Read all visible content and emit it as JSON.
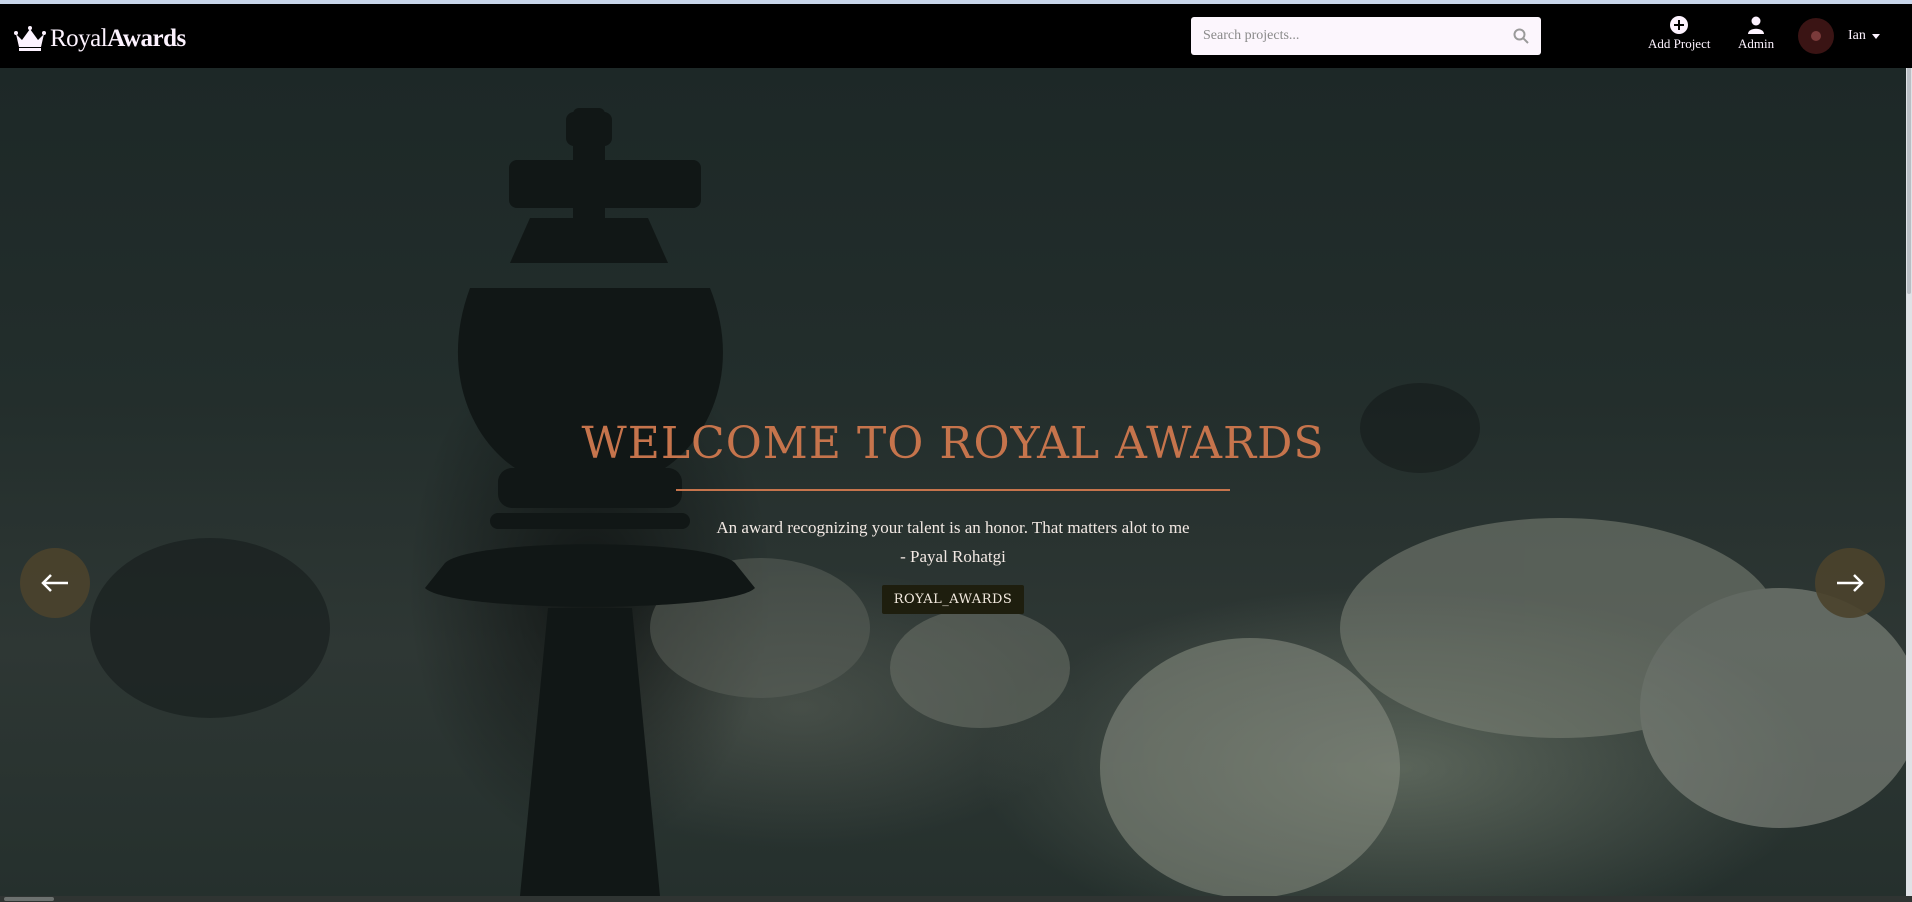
{
  "brand": {
    "part1": "Royal",
    "part2": "Awards"
  },
  "search": {
    "placeholder": "Search projects..."
  },
  "nav": {
    "add_project": "Add Project",
    "admin": "Admin",
    "user_name": "Ian"
  },
  "carousel": {
    "title": "WELCOME TO ROYAL AWARDS",
    "quote_line1": "An award recognizing your talent is an honor. That matters alot to me",
    "quote_line2": "- Payal Rohatgi",
    "button_label": "ROYAL_AWARDS"
  },
  "colors": {
    "accent": "#c6744c",
    "navbar": "#000000",
    "button_bg": "#1e1e0e",
    "arrow_bg": "#4b422c"
  }
}
